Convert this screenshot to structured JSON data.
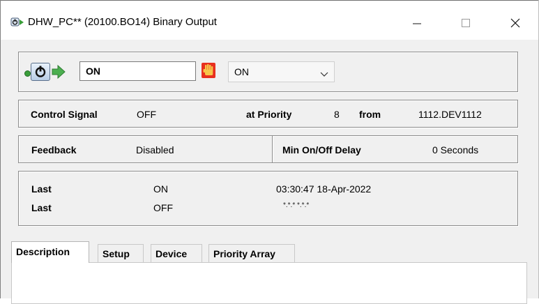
{
  "window": {
    "title": "DHW_PC**  (20100.BO14)  Binary Output",
    "icon": "binary-output-app-icon",
    "controls": {
      "minimize": "—",
      "maximize": "☐",
      "close": "✕"
    }
  },
  "command": {
    "present_value": "ON",
    "command_value": "ON",
    "icons": [
      "status-dot-icon",
      "power-icon",
      "arrow-right-icon",
      "hand-override-icon",
      "chevron-down-icon"
    ],
    "status_color": "#3a9d3a",
    "override_color": "#e8301f"
  },
  "control_signal": {
    "label": "Control Signal",
    "value": "OFF",
    "priority_label": "at Priority",
    "priority_value": "8",
    "from_label": "from",
    "from_value": "1112.DEV1112"
  },
  "feedback": {
    "label": "Feedback",
    "value": "Disabled",
    "delay_label": "Min On/Off Delay",
    "delay_value": "0 Seconds"
  },
  "last": [
    {
      "label": "Last",
      "state": "ON",
      "time": "03:30:47 18-Apr-2022"
    },
    {
      "label": "Last",
      "state": "OFF",
      "time": "*.*.* *.*.*"
    }
  ],
  "tabs": [
    {
      "label": "Description",
      "active": true
    },
    {
      "label": "Setup",
      "active": false
    },
    {
      "label": "Device",
      "active": false
    },
    {
      "label": "Priority Array",
      "active": false
    }
  ]
}
